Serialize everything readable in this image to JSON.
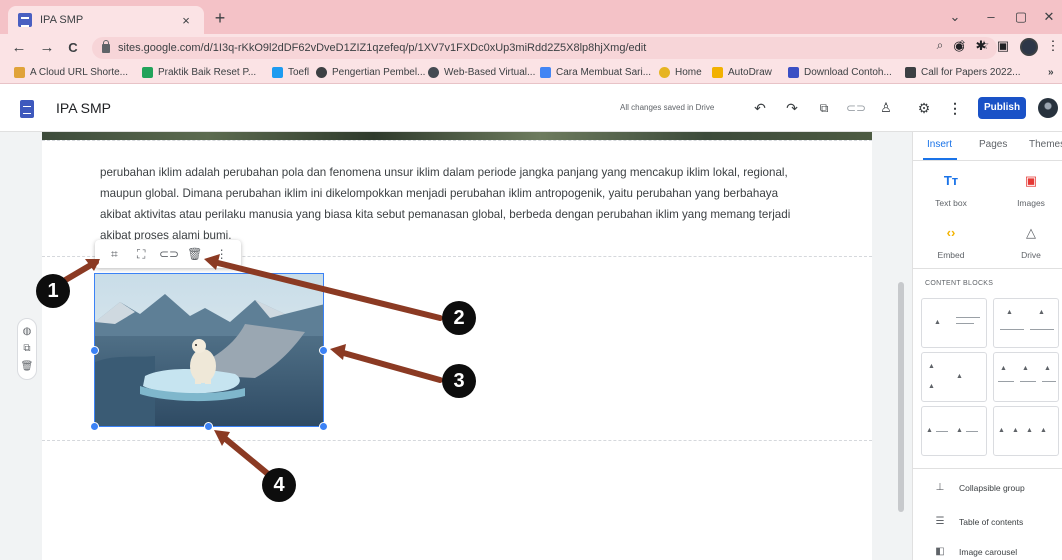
{
  "browser": {
    "tab_title": "IPA SMP",
    "tab_close": "×",
    "new_tab": "+",
    "window_controls": [
      "⌄",
      "–",
      "▢",
      "✕"
    ],
    "url": "sites.google.com/d/1I3q-rKkO9l2dDF62vDveD1ZIZ1qzefeq/p/1XV7v1FXDc0xUp3miRdd2Z5X8lp8hjXmg/edit",
    "nav": {
      "back": "←",
      "forward": "→",
      "reload": "C"
    },
    "omnibox_icons": [
      "zoom-icon",
      "share-icon",
      "star-icon"
    ],
    "bookmarks": [
      {
        "label": "A Cloud URL Shorte...",
        "color": "#e0a33a"
      },
      {
        "label": "Praktik Baik Reset P...",
        "color": "#22a35a"
      },
      {
        "label": "Toefl",
        "color": "#1d9bf0"
      },
      {
        "label": "Pengertian Pembel...",
        "color": "#3c4043"
      },
      {
        "label": "Web-Based Virtual...",
        "color": "#444a52"
      },
      {
        "label": "Cara Membuat Sari...",
        "color": "#4285f4"
      },
      {
        "label": "Home",
        "color": "#e6b422"
      },
      {
        "label": "AutoDraw",
        "color": "#f2b100"
      },
      {
        "label": "Download Contoh...",
        "color": "#3b4fc4"
      },
      {
        "label": "Call for Papers 2022...",
        "color": "#3c4043"
      }
    ],
    "bookmarks_overflow": "»"
  },
  "sites_header": {
    "title": "IPA SMP",
    "saved_status": "All changes saved in Drive",
    "publish_label": "Publish",
    "icons": [
      "undo-icon",
      "redo-icon",
      "preview-icon",
      "link-icon",
      "share-user-icon",
      "settings-icon",
      "more-icon"
    ]
  },
  "content": {
    "paragraph": "perubahan iklim adalah perubahan pola dan fenomena unsur iklim dalam periode jangka panjang yang mencakup iklim lokal, regional, maupun global. Dimana perubahan iklim ini dikelompokkan menjadi perubahan iklim antropogenik, yaitu perubahan yang berbahaya akibat aktivitas atau perilaku manusia yang biasa kita sebut pemanasan global, berbeda dengan perubahan iklim yang memang terjadi akibat proses alami bumi.",
    "image_toolbar": [
      "crop-icon",
      "fit-icon",
      "link-icon",
      "delete-icon",
      "more-icon"
    ],
    "block_tools": [
      "palette-icon",
      "duplicate-icon",
      "trash-icon"
    ]
  },
  "side_panel": {
    "tabs": [
      "Insert",
      "Pages",
      "Themes"
    ],
    "active_tab": "Insert",
    "insert_items": [
      {
        "label": "Text box",
        "icon": "text-box-icon",
        "color": "#1a73e8"
      },
      {
        "label": "Images",
        "icon": "images-icon",
        "color": "#e53935"
      },
      {
        "label": "Embed",
        "icon": "embed-icon",
        "color": "#f4b400"
      },
      {
        "label": "Drive",
        "icon": "drive-icon",
        "color": "#5f6368"
      }
    ],
    "content_blocks_title": "CONTENT BLOCKS",
    "list_items": [
      {
        "label": "Collapsible group",
        "icon": "collapsible-icon"
      },
      {
        "label": "Table of contents",
        "icon": "toc-icon"
      },
      {
        "label": "Image carousel",
        "icon": "carousel-icon"
      }
    ]
  },
  "annotations": [
    {
      "number": "1",
      "target": "crop-tool"
    },
    {
      "number": "2",
      "target": "delete-tool"
    },
    {
      "number": "3",
      "target": "side-handle"
    },
    {
      "number": "4",
      "target": "bottom-handle"
    }
  ],
  "colors": {
    "chrome_tab_strip": "#f4c2c7",
    "chrome_toolbar": "#fbe3e5",
    "publish": "#1a52c7",
    "selection": "#3b82f6",
    "annotation_arrow": "#8b3a23",
    "annotation_badge": "#0d0d0d"
  }
}
